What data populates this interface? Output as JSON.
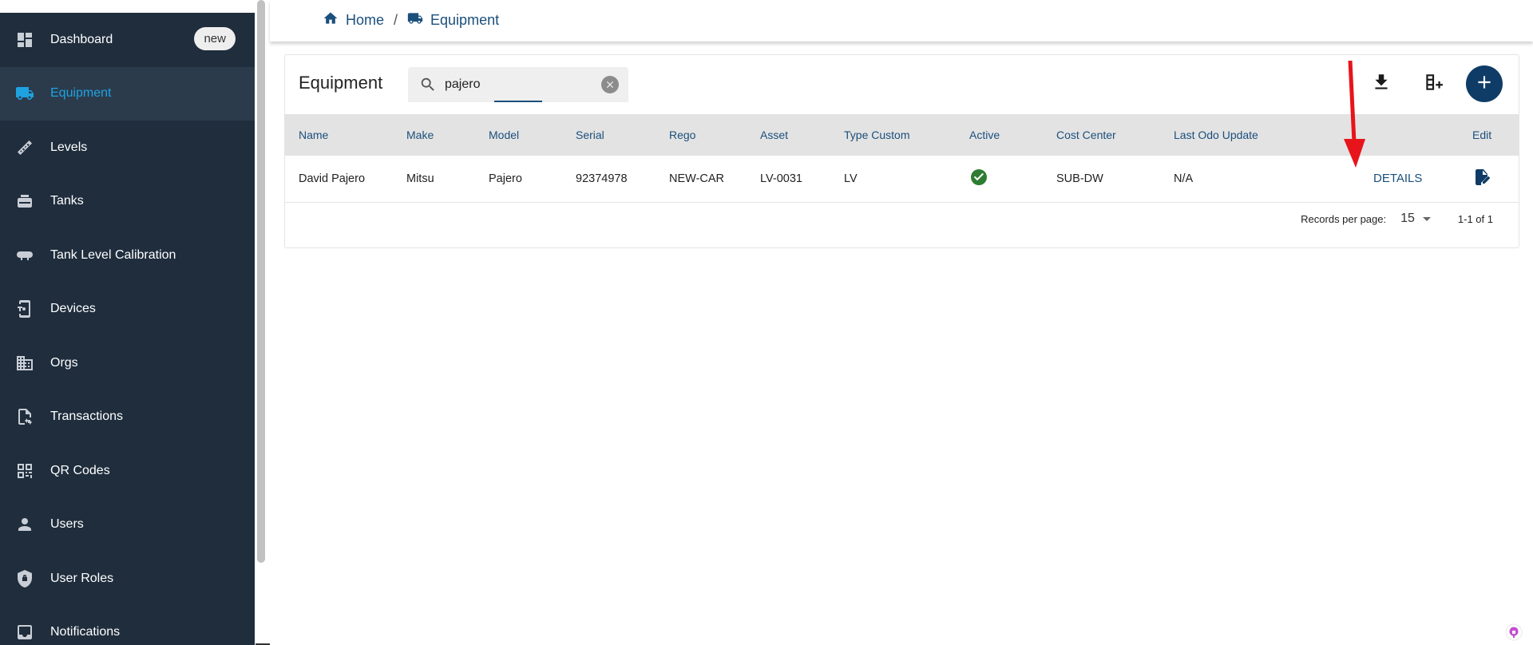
{
  "sidebar": {
    "items": [
      {
        "label": "Dashboard",
        "icon": "dashboard-icon",
        "badge": "new",
        "active": false
      },
      {
        "label": "Equipment",
        "icon": "truck-icon",
        "active": true
      },
      {
        "label": "Levels",
        "icon": "ruler-icon",
        "active": false
      },
      {
        "label": "Tanks",
        "icon": "tank-icon",
        "active": false
      },
      {
        "label": "Tank Level Calibration",
        "icon": "calibration-icon",
        "active": false
      },
      {
        "label": "Devices",
        "icon": "device-icon",
        "active": false
      },
      {
        "label": "Orgs",
        "icon": "building-icon",
        "active": false
      },
      {
        "label": "Transactions",
        "icon": "transactions-icon",
        "active": false
      },
      {
        "label": "QR Codes",
        "icon": "qr-code-icon",
        "active": false
      },
      {
        "label": "Users",
        "icon": "user-icon",
        "active": false
      },
      {
        "label": "User Roles",
        "icon": "shield-icon",
        "active": false
      },
      {
        "label": "Notifications",
        "icon": "inbox-icon",
        "active": false
      }
    ],
    "colors": {
      "background": "#1f2d3d",
      "active_background": "#2b3b4c",
      "active_text": "#1fa2e0"
    }
  },
  "breadcrumb": {
    "home": "Home",
    "separator": "/",
    "current": "Equipment"
  },
  "card": {
    "title": "Equipment",
    "search": {
      "value": "pajero"
    },
    "columns": [
      "Name",
      "Make",
      "Model",
      "Serial",
      "Rego",
      "Asset",
      "Type Custom",
      "Active",
      "Cost Center",
      "Last Odo Update",
      "",
      "Edit"
    ],
    "rows": [
      {
        "name": "David Pajero",
        "make": "Mitsu",
        "model": "Pajero",
        "serial": "92374978",
        "rego": "NEW-CAR",
        "asset": "LV-0031",
        "type_custom": "LV",
        "active": true,
        "cost_center": "SUB-DW",
        "last_odo_update": "N/A",
        "details": "DETAILS"
      }
    ],
    "pagination": {
      "records_per_page_label": "Records per page:",
      "per_page": "15",
      "range": "1-1 of 1"
    }
  },
  "colors": {
    "primary": "#0f3c66",
    "link": "#1b4f7c",
    "active_check": "#2e7d32",
    "annotation_arrow": "#e8141b"
  }
}
